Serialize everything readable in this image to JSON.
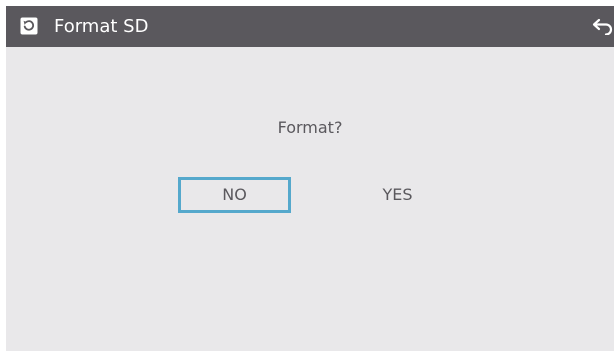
{
  "header": {
    "title": "Format SD",
    "icon": "format-sd-icon",
    "back_icon": "back-arrow-icon",
    "background_color": "#5a585d"
  },
  "dialog": {
    "prompt": "Format?",
    "no_label": "NO",
    "yes_label": "YES",
    "selected": "NO",
    "focus_color": "#55a8cc"
  },
  "background_color": "#e9e8ea"
}
